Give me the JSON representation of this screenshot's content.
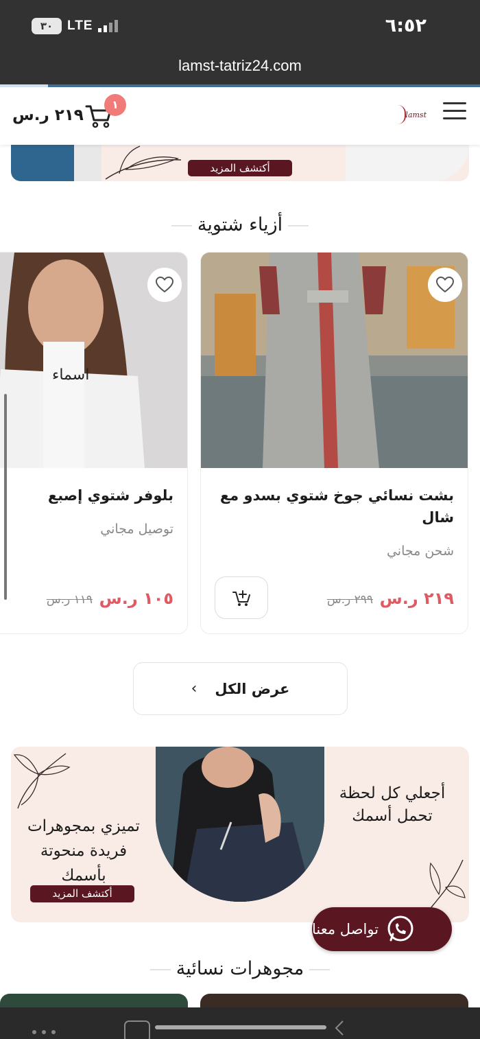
{
  "status": {
    "time": "٦:٥٢",
    "network": "LTE",
    "battery": "٣٠"
  },
  "browser": {
    "url": "lamst-tatriz24.com"
  },
  "header": {
    "logo_text": "lamst",
    "cart_count": "١",
    "cart_total": "٢١٩ ر.س"
  },
  "top_banner": {
    "button": "أكتشف المزيد"
  },
  "section1": {
    "title": "أزياء شتوية"
  },
  "products": [
    {
      "title": "بشت نسائي جوخ شتوي بسدو مع شال",
      "shipping": "شحن مجاني",
      "price": "٢١٩ ر.س",
      "old_price": "٢٩٩ ر.س"
    },
    {
      "title": "بلوفر شتوي إصبع",
      "shipping": "توصيل مجاني",
      "price": "١٠٥ ر.س",
      "old_price": "١١٩ ر.س"
    }
  ],
  "view_all": "عرض الكل",
  "banner2": {
    "right_text_line1": "أجعلي كل لحظة",
    "right_text_line2": "تحمل أسمك",
    "left_text_line1": "تميزي بمجوهرات",
    "left_text_line2": "فريدة منحوتة",
    "left_text_line3": "بأسمك",
    "button": "أكتشف المزيد"
  },
  "whatsapp": {
    "label": "تواصل معنا"
  },
  "section2": {
    "title": "مجوهرات نسائية"
  },
  "colors": {
    "brand": "#5a1721",
    "price": "#e05a63",
    "badge": "#f07b78",
    "banner_bg": "#f9ebe6"
  }
}
